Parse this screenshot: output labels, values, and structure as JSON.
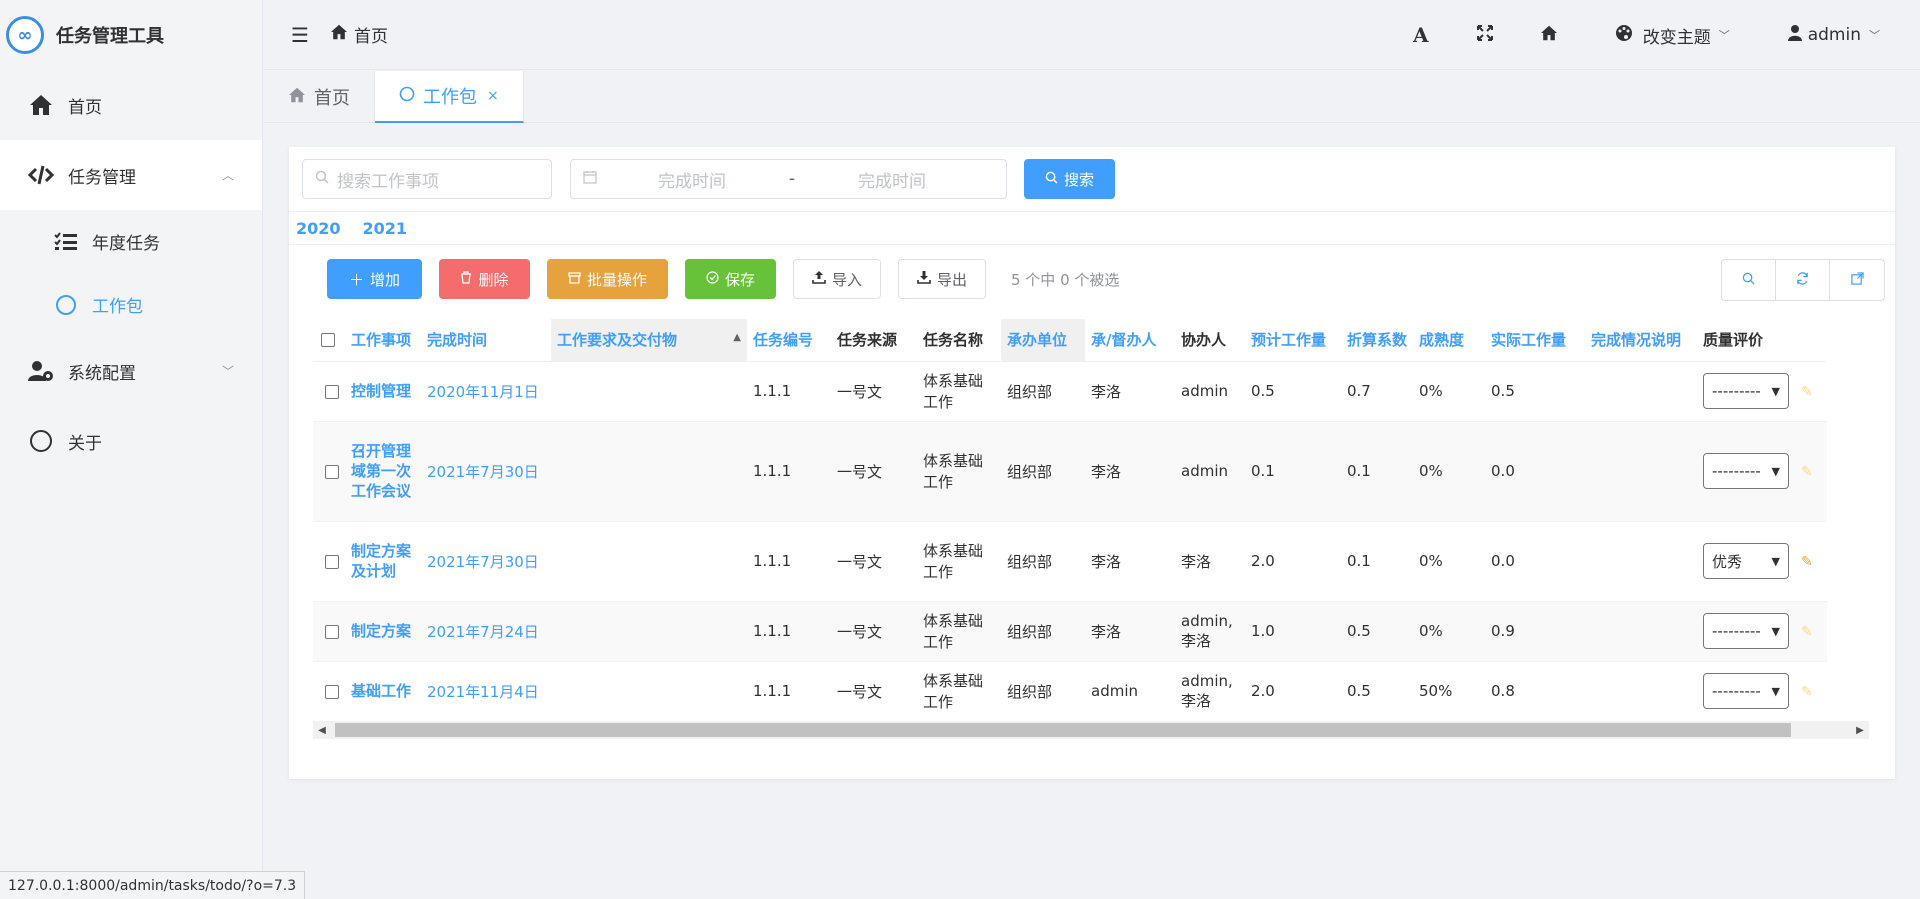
{
  "app": {
    "title": "任务管理工具"
  },
  "sidebar": {
    "home": "首页",
    "task_mgmt": "任务管理",
    "annual_tasks": "年度任务",
    "work_package": "工作包",
    "system_config": "系统配置",
    "about": "关于"
  },
  "header": {
    "breadcrumb": "首页",
    "font_label": "A",
    "theme": "改变主题",
    "user": "admin"
  },
  "tabs": [
    {
      "label": "首页"
    },
    {
      "label": "工作包",
      "close": "×"
    }
  ],
  "search": {
    "placeholder": "搜索工作事项",
    "date_start": "完成时间",
    "date_sep": "-",
    "date_end": "完成时间",
    "button": "搜索"
  },
  "years": [
    "2020",
    "2021"
  ],
  "toolbar": {
    "add": "增加",
    "delete": "删除",
    "batch": "批量操作",
    "save": "保存",
    "import": "导入",
    "export": "导出",
    "selection": "5 个中 0 个被选"
  },
  "table": {
    "headers": [
      "工作事项",
      "完成时间",
      "工作要求及交付物",
      "任务编号",
      "任务来源",
      "任务名称",
      "承办单位",
      "承/督办人",
      "协办人",
      "预计工作量",
      "折算系数",
      "成熟度",
      "实际工作量",
      "完成情况说明",
      "质量评价"
    ],
    "rows": [
      {
        "item": "控制管理",
        "date": "2020年11月1日",
        "req": "",
        "code": "1.1.1",
        "source": "一号文",
        "name": "体系基础工作",
        "unit": "组织部",
        "owner": "李洛",
        "assist": "admin",
        "est": "0.5",
        "factor": "0.7",
        "maturity": "0%",
        "actual": "0.5",
        "note": "",
        "quality": "---------"
      },
      {
        "item": "召开管理域第一次工作会议",
        "date": "2021年7月30日",
        "req": "",
        "code": "1.1.1",
        "source": "一号文",
        "name": "体系基础工作",
        "unit": "组织部",
        "owner": "李洛",
        "assist": "admin",
        "est": "0.1",
        "factor": "0.1",
        "maturity": "0%",
        "actual": "0.0",
        "note": "",
        "quality": "---------"
      },
      {
        "item": "制定方案及计划",
        "date": "2021年7月30日",
        "req": "",
        "code": "1.1.1",
        "source": "一号文",
        "name": "体系基础工作",
        "unit": "组织部",
        "owner": "李洛",
        "assist": "李洛",
        "est": "2.0",
        "factor": "0.1",
        "maturity": "0%",
        "actual": "0.0",
        "note": "",
        "quality": "优秀"
      },
      {
        "item": "制定方案",
        "date": "2021年7月24日",
        "req": "",
        "code": "1.1.1",
        "source": "一号文",
        "name": "体系基础工作",
        "unit": "组织部",
        "owner": "李洛",
        "assist": "admin, 李洛",
        "est": "1.0",
        "factor": "0.5",
        "maturity": "0%",
        "actual": "0.9",
        "note": "",
        "quality": "---------"
      },
      {
        "item": "基础工作",
        "date": "2021年11月4日",
        "req": "",
        "code": "1.1.1",
        "source": "一号文",
        "name": "体系基础工作",
        "unit": "组织部",
        "owner": "admin",
        "assist": "admin, 李洛",
        "est": "2.0",
        "factor": "0.5",
        "maturity": "50%",
        "actual": "0.8",
        "note": "",
        "quality": "---------"
      }
    ]
  },
  "status_url": "127.0.0.1:8000/admin/tasks/todo/?o=7.3"
}
